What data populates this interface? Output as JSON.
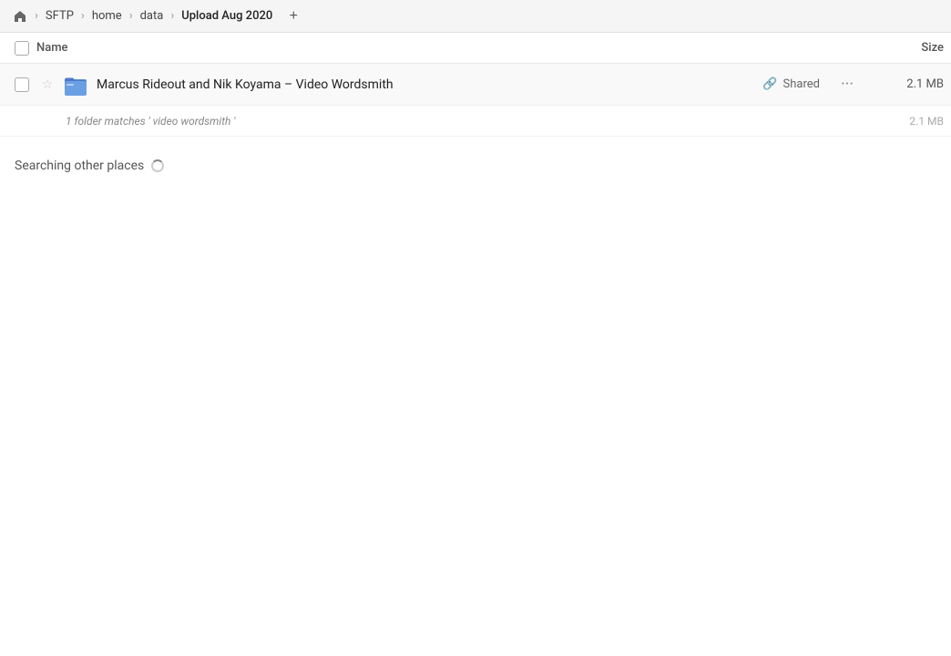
{
  "breadcrumb": {
    "home_label": "⌂",
    "items": [
      {
        "id": "sftp",
        "label": "SFTP"
      },
      {
        "id": "home",
        "label": "home"
      },
      {
        "id": "data",
        "label": "data"
      },
      {
        "id": "upload",
        "label": "Upload Aug 2020"
      }
    ],
    "add_button_label": "+"
  },
  "columns": {
    "name_label": "Name",
    "size_label": "Size"
  },
  "file_row": {
    "name": "Marcus Rideout and Nik Koyama – Video Wordsmith",
    "shared_label": "Shared",
    "size": "2.1 MB",
    "star_icon": "☆",
    "more_icon": "•••"
  },
  "match_row": {
    "text": "1 folder matches ' video wordsmith '",
    "size": "2.1 MB"
  },
  "searching": {
    "label": "Searching other places"
  },
  "icons": {
    "link": "🔗"
  }
}
